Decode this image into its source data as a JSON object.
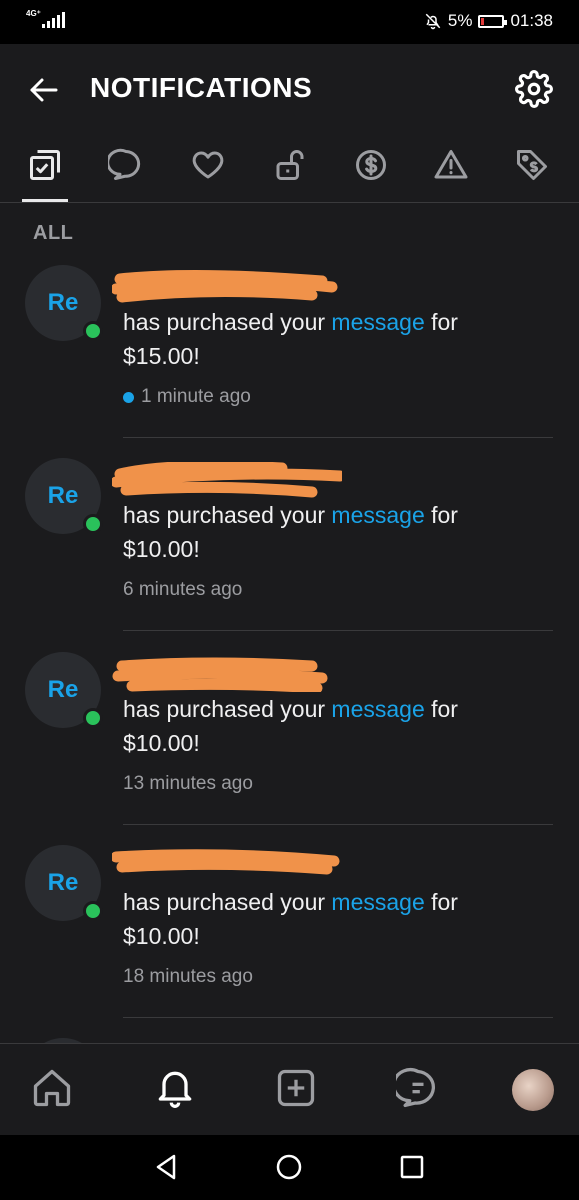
{
  "status_bar": {
    "network": "4G⁺",
    "battery_percent": "5%",
    "time": "01:38"
  },
  "header": {
    "title": "NOTIFICATIONS"
  },
  "tabs": [
    {
      "icon": "checklist-icon",
      "active": true
    },
    {
      "icon": "comment-icon"
    },
    {
      "icon": "heart-icon"
    },
    {
      "icon": "unlock-icon"
    },
    {
      "icon": "dollar-icon"
    },
    {
      "icon": "warning-icon"
    },
    {
      "icon": "tag-icon"
    }
  ],
  "section_label": "ALL",
  "notifications": [
    {
      "avatar_text": "Re",
      "text_before": "has purchased your ",
      "link_text": "message",
      "text_after": " for",
      "amount": "$15.00!",
      "time": "1 minute ago",
      "unread": true
    },
    {
      "avatar_text": "Re",
      "text_before": "has purchased your ",
      "link_text": "message",
      "text_after": " for",
      "amount": "$10.00!",
      "time": "6 minutes ago",
      "unread": false
    },
    {
      "avatar_text": "Re",
      "text_before": "has purchased your ",
      "link_text": "message",
      "text_after": " for",
      "amount": "$10.00!",
      "time": "13 minutes ago",
      "unread": false
    },
    {
      "avatar_text": "Re",
      "text_before": "has purchased your ",
      "link_text": "message",
      "text_after": " for",
      "amount": "$10.00!",
      "time": "18 minutes ago",
      "unread": false
    }
  ],
  "bottom_nav": [
    "home-icon",
    "bell-icon",
    "add-post-icon",
    "messages-icon",
    "profile-avatar"
  ],
  "colors": {
    "background": "#1b1b1d",
    "accent": "#1aa3e8",
    "online": "#2ac25b",
    "redaction": "#f0924a"
  }
}
